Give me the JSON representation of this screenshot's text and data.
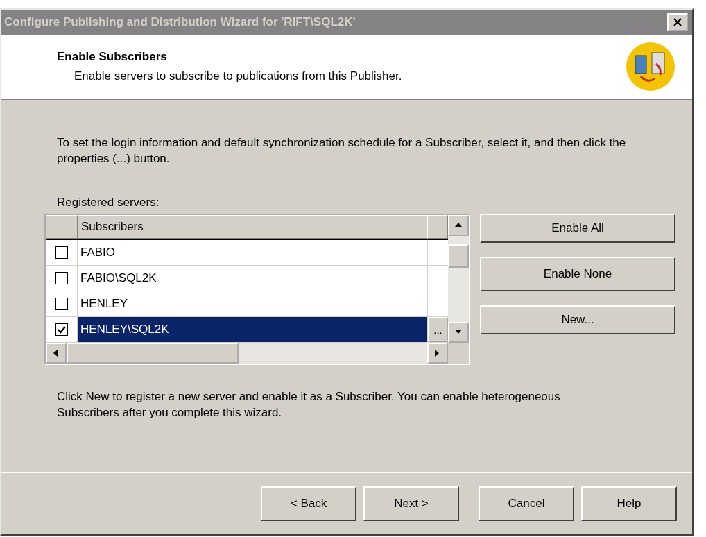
{
  "window": {
    "title": "Configure Publishing and Distribution Wizard for 'RIFT\\SQL2K'"
  },
  "header": {
    "title": "Enable Subscribers",
    "subtitle": "Enable servers to subscribe to publications from this Publisher."
  },
  "instructions": "To set the login information and default synchronization schedule for a Subscriber, select it, and then click the properties (...) button.",
  "servers_label": "Registered servers:",
  "grid": {
    "columns": [
      "Subscribers"
    ],
    "properties_button": "...",
    "rows": [
      {
        "name": "FABIO",
        "checked": false,
        "selected": false
      },
      {
        "name": "FABIO\\SQL2K",
        "checked": false,
        "selected": false
      },
      {
        "name": "HENLEY",
        "checked": false,
        "selected": false
      },
      {
        "name": "HENLEY\\SQL2K",
        "checked": true,
        "selected": true
      }
    ]
  },
  "side_buttons": [
    "Enable All",
    "Enable None",
    "New..."
  ],
  "note": "Click New to register a new server and enable it as a Subscriber. You can enable heterogeneous Subscribers after you complete this wizard.",
  "nav_buttons": [
    "< Back",
    "Next >",
    "Cancel",
    "Help"
  ]
}
